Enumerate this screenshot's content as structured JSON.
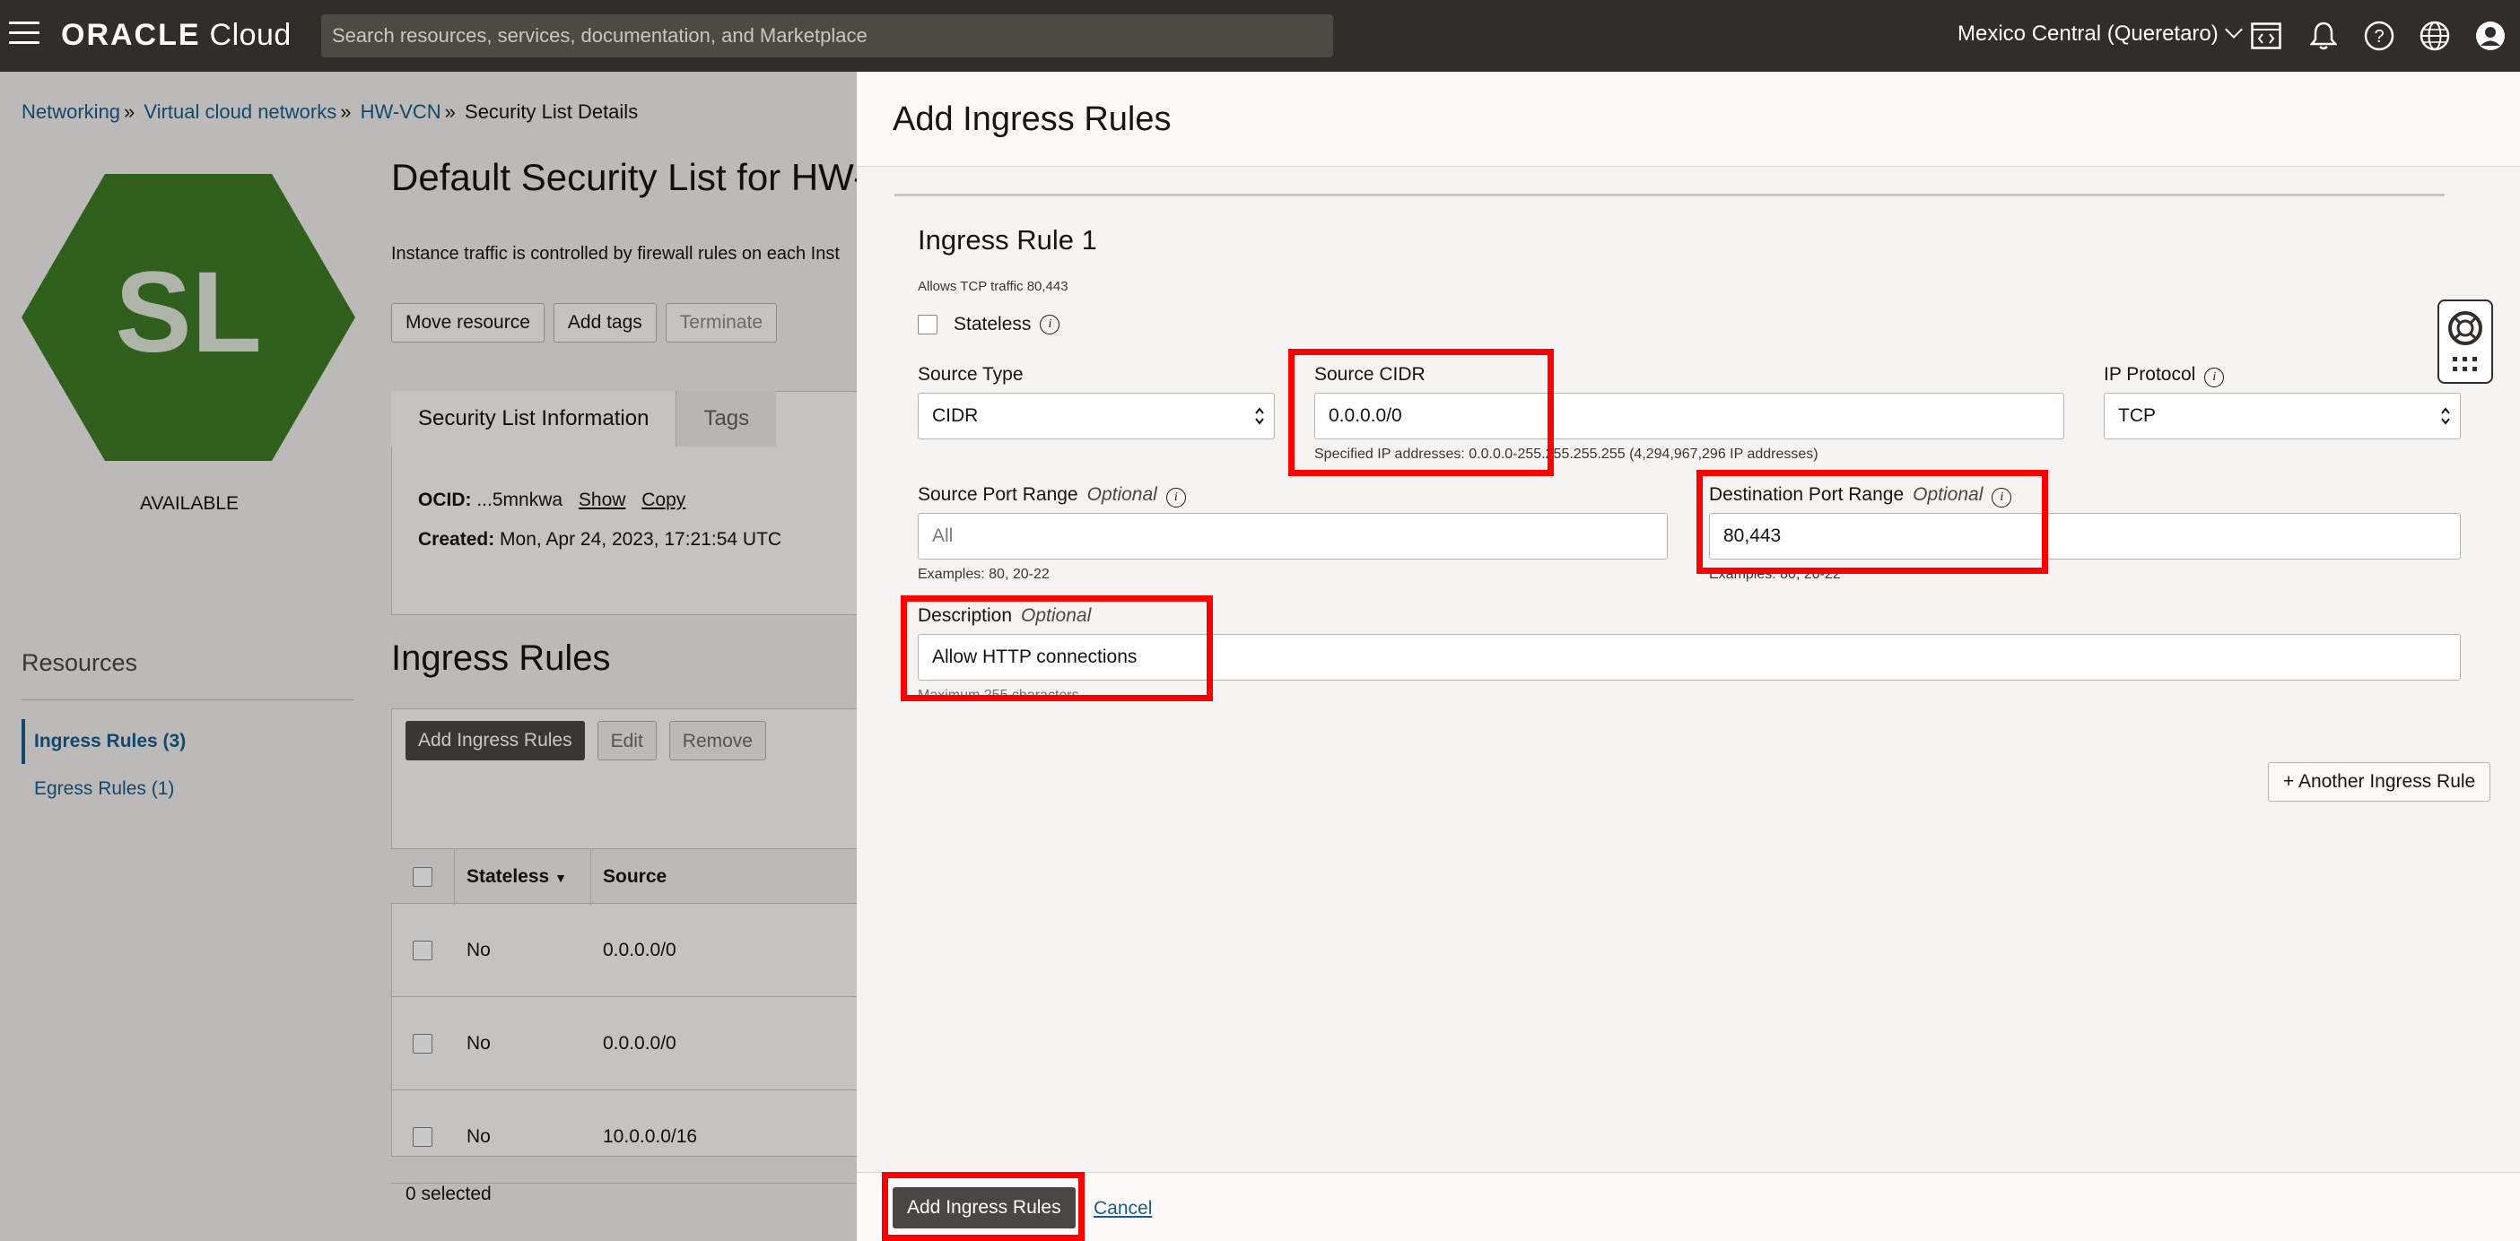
{
  "topbar": {
    "brand_bold": "ORACLE",
    "brand_rest": " Cloud",
    "search_placeholder": "Search resources, services, documentation, and Marketplace",
    "region": "Mexico Central (Queretaro)"
  },
  "breadcrumb": {
    "items": [
      "Networking",
      "Virtual cloud networks",
      "HW-VCN",
      "Security List Details"
    ],
    "separator": "»"
  },
  "resource": {
    "badge_text": "SL",
    "badge_color": "#3e7a27",
    "status": "AVAILABLE",
    "title": "Default Security List for HW-",
    "description": "Instance traffic is controlled by firewall rules on each Inst",
    "actions": [
      "Move resource",
      "Add tags",
      "Terminate"
    ]
  },
  "info_tabs": [
    "Security List Information",
    "Tags"
  ],
  "info": {
    "ocid_label": "OCID:",
    "ocid_value": "...5mnkwa",
    "show_label": "Show",
    "copy_label": "Copy",
    "created_label": "Created:",
    "created_value": "Mon, Apr 24, 2023, 17:21:54 UTC"
  },
  "resources": {
    "heading": "Resources",
    "items": [
      "Ingress Rules (3)",
      "Egress Rules (1)"
    ]
  },
  "ingress": {
    "heading": "Ingress Rules",
    "buttons": [
      "Add Ingress Rules",
      "Edit",
      "Remove"
    ],
    "columns": [
      "Stateless",
      "Source"
    ],
    "rows": [
      {
        "stateless": "No",
        "source": "0.0.0.0/0"
      },
      {
        "stateless": "No",
        "source": "0.0.0.0/0"
      },
      {
        "stateless": "No",
        "source": "10.0.0.0/16"
      }
    ],
    "selected_count": "0 selected"
  },
  "drawer": {
    "title": "Add Ingress Rules",
    "rule_title": "Ingress Rule 1",
    "rule_subtitle": "Allows TCP traffic 80,443",
    "stateless_label": "Stateless",
    "source_type": {
      "label": "Source Type",
      "value": "CIDR"
    },
    "source_cidr": {
      "label": "Source CIDR",
      "value": "0.0.0.0/0",
      "hint": "Specified IP addresses: 0.0.0.0-255.255.255.255 (4,294,967,296 IP addresses)"
    },
    "ip_protocol": {
      "label": "IP Protocol",
      "value": "TCP"
    },
    "source_port": {
      "label": "Source Port Range",
      "optional": "Optional",
      "placeholder": "All",
      "hint": "Examples: 80, 20-22"
    },
    "dest_port": {
      "label": "Destination Port Range",
      "optional": "Optional",
      "value": "80,443",
      "hint": "Examples: 80, 20-22"
    },
    "description": {
      "label": "Description",
      "optional": "Optional",
      "value": "Allow HTTP connections",
      "hint": "Maximum 255 characters"
    },
    "another_rule": "+ Another Ingress Rule",
    "submit": "Add Ingress Rules",
    "cancel": "Cancel"
  },
  "colors": {
    "topbar": "#312d2a",
    "highlight": "#ff0000",
    "link": "#1a5c8a",
    "primary_button": "#4a4643"
  },
  "icons": [
    "hamburger-menu-icon",
    "code-editor-icon",
    "bell-icon",
    "help-icon",
    "globe-icon",
    "user-profile-icon",
    "info-icon",
    "select-arrows-icon",
    "lifebuoy-icon",
    "apps-grid-icon"
  ]
}
